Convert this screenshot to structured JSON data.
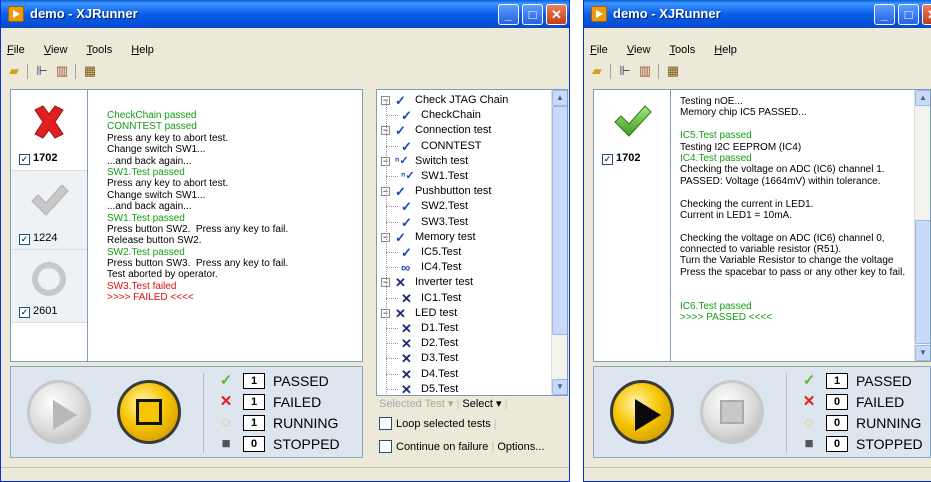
{
  "colors": {
    "pass": "#10a010",
    "fail": "#e01010",
    "title_bar": "#0b5ee8",
    "panel_bg": "#dde5ef"
  },
  "window_left": {
    "title": "demo - XJRunner",
    "menu": [
      {
        "key": "F",
        "rest": "ile"
      },
      {
        "key": "V",
        "rest": "iew"
      },
      {
        "key": "T",
        "rest": "ools"
      },
      {
        "key": "H",
        "rest": "elp"
      }
    ],
    "toolbar_icons": [
      "open-folder-icon",
      "tree-icon",
      "book-icon",
      "properties-icon"
    ],
    "side_items": [
      {
        "icon": "fail-x-icon",
        "label": "1702",
        "checked": true
      },
      {
        "icon": "pass-check-icon",
        "label": "1224",
        "checked": true
      },
      {
        "icon": "running-icon",
        "label": "2601",
        "checked": true
      }
    ],
    "log": [
      {
        "text": "CheckChain passed",
        "color": "green"
      },
      {
        "text": "CONNTEST passed",
        "color": "green"
      },
      {
        "text": "Press any key to abort test.",
        "color": "black"
      },
      {
        "text": "Change switch SW1...",
        "color": "black"
      },
      {
        "text": "...and back again...",
        "color": "black"
      },
      {
        "text": "SW1.Test passed",
        "color": "green"
      },
      {
        "text": "Press any key to abort test.",
        "color": "black"
      },
      {
        "text": "Change switch SW1...",
        "color": "black"
      },
      {
        "text": "...and back again...",
        "color": "black"
      },
      {
        "text": "SW1.Test passed",
        "color": "green"
      },
      {
        "text": "Press button SW2.  Press any key to fail.",
        "color": "black"
      },
      {
        "text": "Release button SW2.",
        "color": "black"
      },
      {
        "text": "SW2.Test passed",
        "color": "green"
      },
      {
        "text": "Press button SW3.  Press any key to fail.",
        "color": "black"
      },
      {
        "text": "Test aborted by operator.",
        "color": "black"
      },
      {
        "text": "SW3.Test failed",
        "color": "red"
      },
      {
        "text": ">>>> FAILED <<<<",
        "color": "red"
      }
    ],
    "tree": [
      {
        "label": "Check JTAG Chain",
        "level": 0,
        "status": "pass"
      },
      {
        "label": "CheckChain",
        "level": 1,
        "status": "pass"
      },
      {
        "label": "Connection test",
        "level": 0,
        "status": "pass"
      },
      {
        "label": "CONNTEST",
        "level": 1,
        "status": "pass"
      },
      {
        "label": "Switch test",
        "level": 0,
        "status": "partial"
      },
      {
        "label": "SW1.Test",
        "level": 1,
        "status": "partial"
      },
      {
        "label": "Pushbutton test",
        "level": 0,
        "status": "pass"
      },
      {
        "label": "SW2.Test",
        "level": 1,
        "status": "pass"
      },
      {
        "label": "SW3.Test",
        "level": 1,
        "status": "pass"
      },
      {
        "label": "Memory test",
        "level": 0,
        "status": "pass"
      },
      {
        "label": "IC5.Test",
        "level": 1,
        "status": "pass"
      },
      {
        "label": "IC4.Test",
        "level": 1,
        "status": "loop"
      },
      {
        "label": "Inverter test",
        "level": 0,
        "status": "fail"
      },
      {
        "label": "IC1.Test",
        "level": 1,
        "status": "fail"
      },
      {
        "label": "LED test",
        "level": 0,
        "status": "fail"
      },
      {
        "label": "D1.Test",
        "level": 1,
        "status": "fail"
      },
      {
        "label": "D2.Test",
        "level": 1,
        "status": "fail"
      },
      {
        "label": "D3.Test",
        "level": 1,
        "status": "fail"
      },
      {
        "label": "D4.Test",
        "level": 1,
        "status": "fail"
      },
      {
        "label": "D5.Test",
        "level": 1,
        "status": "fail"
      }
    ],
    "tree_footer": {
      "selected_test": "Selected Test",
      "select": "Select"
    },
    "options": {
      "loop": "Loop selected tests",
      "continue": "Continue on failure",
      "options_link": "Options..."
    },
    "stats": [
      {
        "icon": "check-icon",
        "count": "1",
        "label": "PASSED"
      },
      {
        "icon": "x-icon",
        "count": "1",
        "label": "FAILED"
      },
      {
        "icon": "running-icon",
        "count": "1",
        "label": "RUNNING"
      },
      {
        "icon": "stop-icon",
        "count": "0",
        "label": "STOPPED"
      }
    ]
  },
  "window_right": {
    "title": "demo - XJRunner",
    "menu": [
      {
        "key": "F",
        "rest": "ile"
      },
      {
        "key": "V",
        "rest": "iew"
      },
      {
        "key": "T",
        "rest": "ools"
      },
      {
        "key": "H",
        "rest": "elp"
      }
    ],
    "side_items": [
      {
        "icon": "pass-check-icon",
        "label": "1702",
        "checked": true
      }
    ],
    "log": [
      {
        "text": "Testing nOE...",
        "color": "black"
      },
      {
        "text": "Memory chip IC5 PASSED...",
        "color": "black"
      },
      {
        "text": "",
        "color": "black"
      },
      {
        "text": "IC5.Test passed",
        "color": "green"
      },
      {
        "text": "Testing I2C EEPROM (IC4)",
        "color": "black"
      },
      {
        "text": "IC4.Test passed",
        "color": "green"
      },
      {
        "text": "Checking the voltage on ADC (IC6) channel 1.",
        "color": "black"
      },
      {
        "text": "PASSED: Voltage (1664mV) within tolerance.",
        "color": "black"
      },
      {
        "text": "",
        "color": "black"
      },
      {
        "text": "Checking the current in LED1.",
        "color": "black"
      },
      {
        "text": "Current in LED1 = 10mA.",
        "color": "black"
      },
      {
        "text": "",
        "color": "black"
      },
      {
        "text": "Checking the voltage on ADC (IC6) channel 0,",
        "color": "black"
      },
      {
        "text": "connected to variable resistor (R51).",
        "color": "black"
      },
      {
        "text": "Turn the Variable Resistor to change the voltage",
        "color": "black"
      },
      {
        "text": "Press the spacebar to pass or any other key to fail.",
        "color": "black"
      },
      {
        "text": "",
        "color": "black"
      },
      {
        "text": "",
        "color": "black"
      },
      {
        "text": "IC6.Test passed",
        "color": "green"
      },
      {
        "text": ">>>> PASSED <<<<",
        "color": "green"
      }
    ],
    "stats": [
      {
        "icon": "check-icon",
        "count": "1",
        "label": "PASSED"
      },
      {
        "icon": "x-icon",
        "count": "0",
        "label": "FAILED"
      },
      {
        "icon": "running-icon",
        "count": "0",
        "label": "RUNNING"
      },
      {
        "icon": "stop-icon",
        "count": "0",
        "label": "STOPPED"
      }
    ]
  }
}
